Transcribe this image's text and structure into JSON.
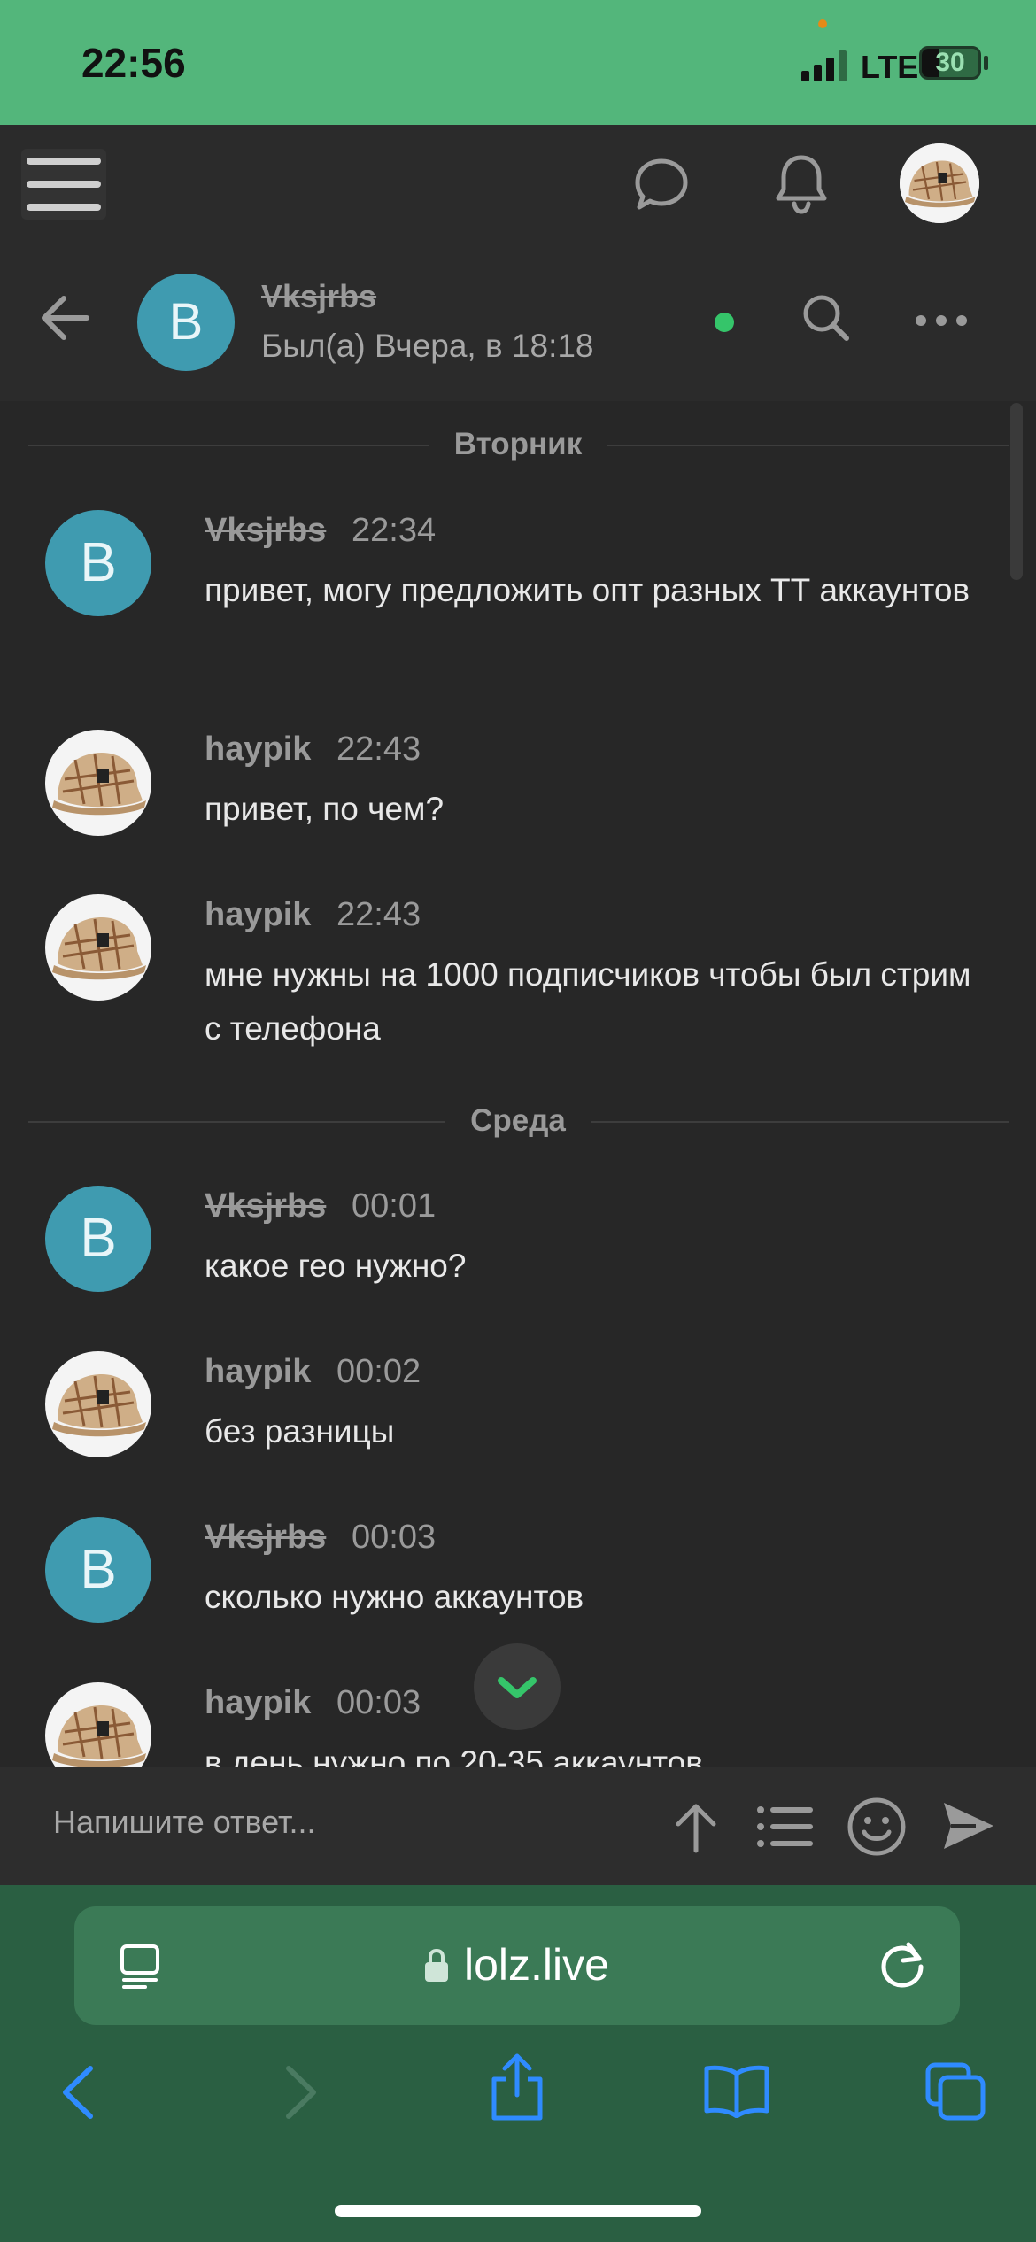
{
  "status_bar": {
    "time": "22:56",
    "network": "LTE",
    "battery": "30"
  },
  "chat_header": {
    "name": "Vksjrbs",
    "avatar_letter": "B",
    "last_seen": "Был(а) Вчера, в 18:18"
  },
  "days": {
    "tuesday": "Вторник",
    "wednesday": "Среда"
  },
  "messages": [
    {
      "author": "Vksjrbs",
      "avatar_letter": "B",
      "time": "22:34",
      "text": "привет, могу предложить опт разных ТТ аккаунтов"
    },
    {
      "author": "haypik",
      "time": "22:43",
      "text": "привет, по чем?"
    },
    {
      "author": "haypik",
      "time": "22:43",
      "text": "мне нужны на 1000 подписчиков чтобы был стрим с телефона"
    },
    {
      "author": "Vksjrbs",
      "avatar_letter": "B",
      "time": "00:01",
      "text": "какое гео нужно?"
    },
    {
      "author": "haypik",
      "time": "00:02",
      "text": "без разницы"
    },
    {
      "author": "Vksjrbs",
      "avatar_letter": "B",
      "time": "00:03",
      "text": "сколько нужно аккаунтов"
    },
    {
      "author": "haypik",
      "time": "00:03",
      "text": "в день нужно по 20-35 аккаунтов"
    }
  ],
  "composer": {
    "placeholder": "Напишите ответ..."
  },
  "browser": {
    "url": "lolz.live"
  },
  "colors": {
    "accent_green": "#53b67b",
    "avatar_blue": "#3f9bb0",
    "online": "#35c56a",
    "safari_bar": "#2a5f42"
  }
}
